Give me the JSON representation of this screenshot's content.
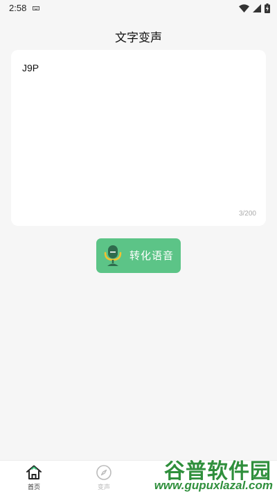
{
  "status_bar": {
    "time": "2:58",
    "icons": [
      "keyboard-icon",
      "wifi-icon",
      "signal-icon",
      "battery-charging-icon"
    ]
  },
  "header": {
    "title": "文字变声"
  },
  "editor": {
    "text": "J9P",
    "counter": "3/200"
  },
  "convert_button": {
    "label": "转化语音",
    "icon": "microphone-icon"
  },
  "bottom_nav": {
    "items": [
      {
        "label": "首页",
        "icon": "home-icon",
        "active": true
      },
      {
        "label": "变声",
        "icon": "compass-icon",
        "active": false
      }
    ]
  },
  "watermark": {
    "title": "谷普软件园",
    "url": "www.gupuxlazal.com"
  },
  "colors": {
    "background": "#f6f6f6",
    "card": "#ffffff",
    "accent_green": "#5cc487",
    "mic_yellow": "#f2c230",
    "mic_dark": "#2f6b4d",
    "counter_gray": "#aaaaaa"
  }
}
